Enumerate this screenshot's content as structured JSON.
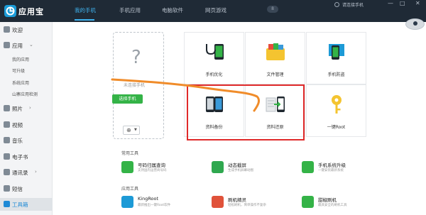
{
  "app": {
    "title": "应用宝"
  },
  "tabs": [
    {
      "label": "我的手机"
    },
    {
      "label": "手机应用"
    },
    {
      "label": "电脑软件"
    },
    {
      "label": "网页游戏"
    }
  ],
  "header": {
    "badge": "8",
    "login": "请连接手机"
  },
  "window_controls": [
    "—",
    "□",
    "✕"
  ],
  "sidebar": {
    "welcome": "欢迎",
    "apps": "应用",
    "apps_sub": [
      "我的应用",
      "可升级",
      "系统应用",
      "山寨应用检测"
    ],
    "photos": "照片",
    "video": "视频",
    "music": "音乐",
    "ebook": "电子书",
    "contacts": "通讯录",
    "sms": "短信",
    "toolbox": "工具箱"
  },
  "phone": {
    "placeholder": "?",
    "hint": "未连接手机",
    "select_button": "选择手机"
  },
  "tiles": [
    {
      "label": "手机优化"
    },
    {
      "label": "文件管理"
    },
    {
      "label": "手机防盗"
    },
    {
      "label": "资料备份"
    },
    {
      "label": "资料还原"
    },
    {
      "label": "一键Root"
    }
  ],
  "common_tools": {
    "title": "常用工具",
    "items": [
      {
        "name": "号码归属查询",
        "desc": "支持国内运营商号码"
      },
      {
        "name": "动态截屏",
        "desc": "生成手机屏幕动图"
      },
      {
        "name": "手机系统升级",
        "desc": "一键安装最新系统"
      }
    ]
  },
  "app_tools": {
    "title": "应用工具",
    "items": [
      {
        "name": "KingRoot",
        "desc": "最新推出一键Root软件"
      },
      {
        "name": "刷机精灵",
        "desc": "轻松刷机，简单操作不复杂"
      },
      {
        "name": "甜椒刷机",
        "desc": "最具安全的刷机工具"
      }
    ]
  },
  "colors": {
    "topbar": "#1f2a36",
    "accent": "#3fb3ef",
    "green": "#34b347",
    "red_box": "#e02a2a",
    "annotation": "#f08c2a"
  }
}
